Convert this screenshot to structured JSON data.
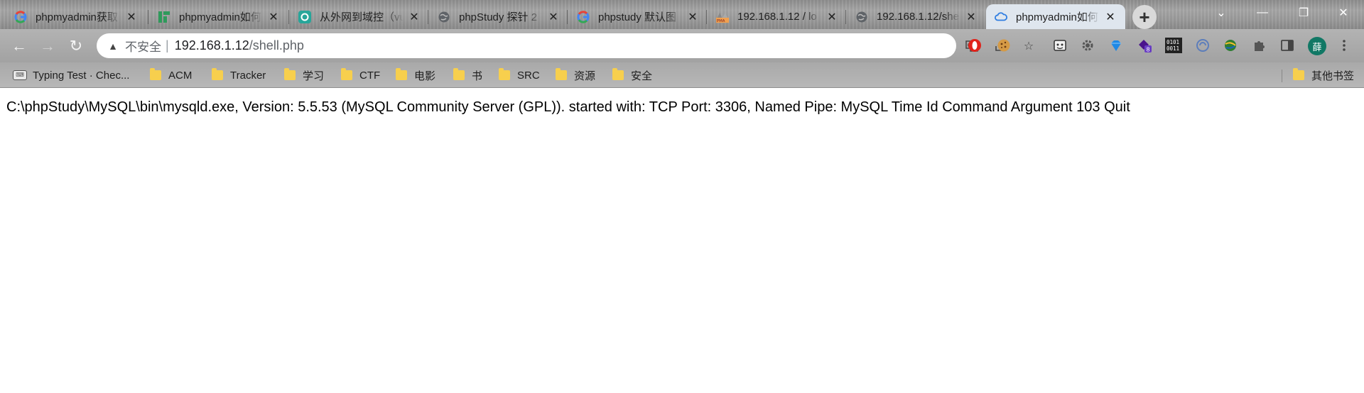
{
  "tabs": [
    {
      "title": "phpmyadmin获取",
      "favicon": "google-icon",
      "active": false
    },
    {
      "title": "phpmyadmin如何",
      "favicon": "tencent-cloud-icon",
      "active": false
    },
    {
      "title": "从外网到域控（vu",
      "favicon": "freebuf-icon",
      "active": false
    },
    {
      "title": "phpStudy 探针 2",
      "favicon": "globe-icon",
      "active": false
    },
    {
      "title": "phpstudy 默认图",
      "favicon": "google-icon",
      "active": false
    },
    {
      "title": "192.168.1.12 / lo",
      "favicon": "phpmyadmin-icon",
      "active": false
    },
    {
      "title": "192.168.1.12/she",
      "favicon": "globe-icon",
      "active": false
    },
    {
      "title": "phpmyadmin如何",
      "favicon": "cloud-icon",
      "active": true
    }
  ],
  "toolbar": {
    "security_label": "不安全",
    "url_host": "192.168.1.12",
    "url_path": "/shell.php",
    "profile_initial": "薛"
  },
  "extensions": {
    "badge_count": "8",
    "binary_label_top": "0101",
    "binary_label_bottom": "0011"
  },
  "bookmarks": [
    {
      "label": "Typing Test · Chec...",
      "icon": "keyboard-icon"
    },
    {
      "label": "ACM",
      "icon": "folder-icon"
    },
    {
      "label": "Tracker",
      "icon": "folder-icon"
    },
    {
      "label": "学习",
      "icon": "folder-icon"
    },
    {
      "label": "CTF",
      "icon": "folder-icon"
    },
    {
      "label": "电影",
      "icon": "folder-icon"
    },
    {
      "label": "书",
      "icon": "folder-icon"
    },
    {
      "label": "SRC",
      "icon": "folder-icon"
    },
    {
      "label": "资源",
      "icon": "folder-icon"
    },
    {
      "label": "安全",
      "icon": "folder-icon"
    }
  ],
  "other_bookmarks": "其他书签",
  "page": {
    "text": "C:\\phpStudy\\MySQL\\bin\\mysqld.exe, Version: 5.5.53 (MySQL Community Server (GPL)). started with: TCP Port: 3306, Named Pipe: MySQL Time Id Command Argument 103 Quit"
  },
  "colors": {
    "active_tab": "#dfe6ee",
    "profile": "#117865",
    "folder": "#f7cf4d"
  }
}
